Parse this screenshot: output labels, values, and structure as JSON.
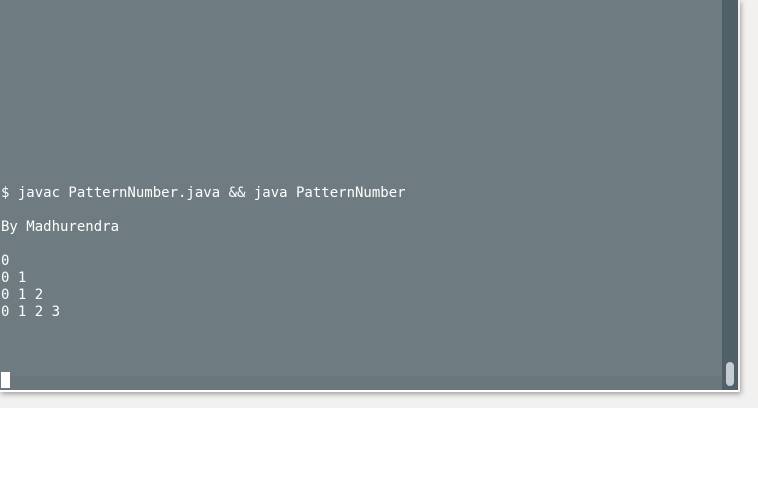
{
  "terminal": {
    "lines": [
      "$ javac PatternNumber.java && java PatternNumber",
      "",
      "By Madhurendra",
      "",
      "0",
      "0 1",
      "0 1 2",
      "0 1 2 3"
    ]
  },
  "colors": {
    "terminal_background": "#6e7b80",
    "terminal_text": "#ffffff",
    "scrollbar_track": "#4f6068",
    "scrollbar_thumb": "#c4cdd1"
  }
}
